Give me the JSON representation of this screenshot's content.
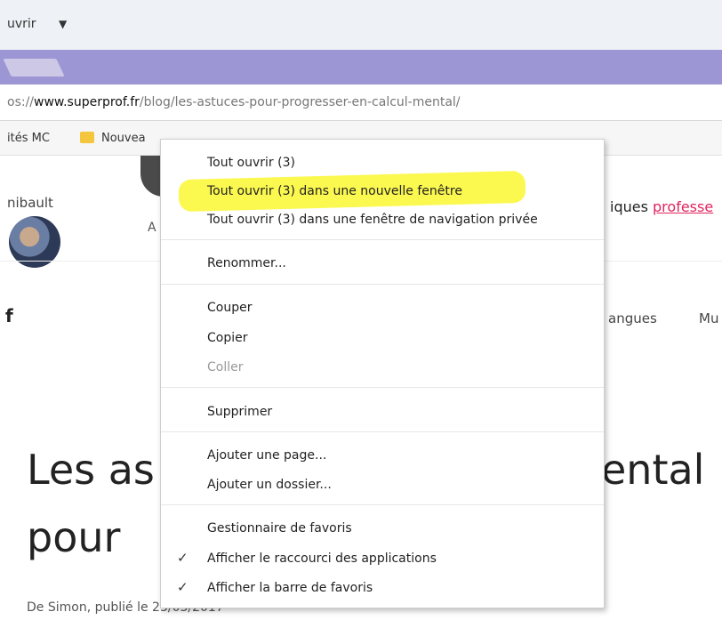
{
  "top_menu": {
    "label": "uvrir",
    "caret": "▼"
  },
  "url_bar": {
    "prefix": "os://",
    "domain": "www.superprof.fr",
    "path": "/blog/les-astuces-pour-progresser-en-calcul-mental/"
  },
  "bookmarks_bar": {
    "item1": "ités MC",
    "item2": "Nouvea"
  },
  "page": {
    "author_partial": "nibault",
    "a_partial": "A",
    "right_partial": "iques ",
    "right_link": "professe",
    "f_partial": "f",
    "nav_partial_1": "angues",
    "nav_partial_2": "Mu",
    "headline_line1_left": "Les as",
    "headline_line1_right": "ental",
    "headline_line2": "pour",
    "byline": "De Simon, publié le 23/03/2017"
  },
  "context_menu": {
    "items": [
      {
        "label": "Tout ouvrir (3)",
        "enabled": true,
        "checked": false
      },
      {
        "label": "Tout ouvrir (3) dans une nouvelle fenêtre",
        "enabled": true,
        "checked": false,
        "highlighted": true
      },
      {
        "label": "Tout ouvrir (3) dans une fenêtre de navigation privée",
        "enabled": true,
        "checked": false
      },
      {
        "label": "Renommer...",
        "enabled": true,
        "checked": false
      },
      {
        "label": "Couper",
        "enabled": true,
        "checked": false
      },
      {
        "label": "Copier",
        "enabled": true,
        "checked": false
      },
      {
        "label": "Coller",
        "enabled": false,
        "checked": false
      },
      {
        "label": "Supprimer",
        "enabled": true,
        "checked": false
      },
      {
        "label": "Ajouter une page...",
        "enabled": true,
        "checked": false
      },
      {
        "label": "Ajouter un dossier...",
        "enabled": true,
        "checked": false
      },
      {
        "label": "Gestionnaire de favoris",
        "enabled": true,
        "checked": false
      },
      {
        "label": "Afficher le raccourci des applications",
        "enabled": true,
        "checked": true
      },
      {
        "label": "Afficher la barre de favoris",
        "enabled": true,
        "checked": true
      }
    ],
    "check_glyph": "✓",
    "highlight_color": "#fbf84f"
  },
  "colors": {
    "tabbar": "#9c97d4",
    "link": "#e0245e"
  }
}
